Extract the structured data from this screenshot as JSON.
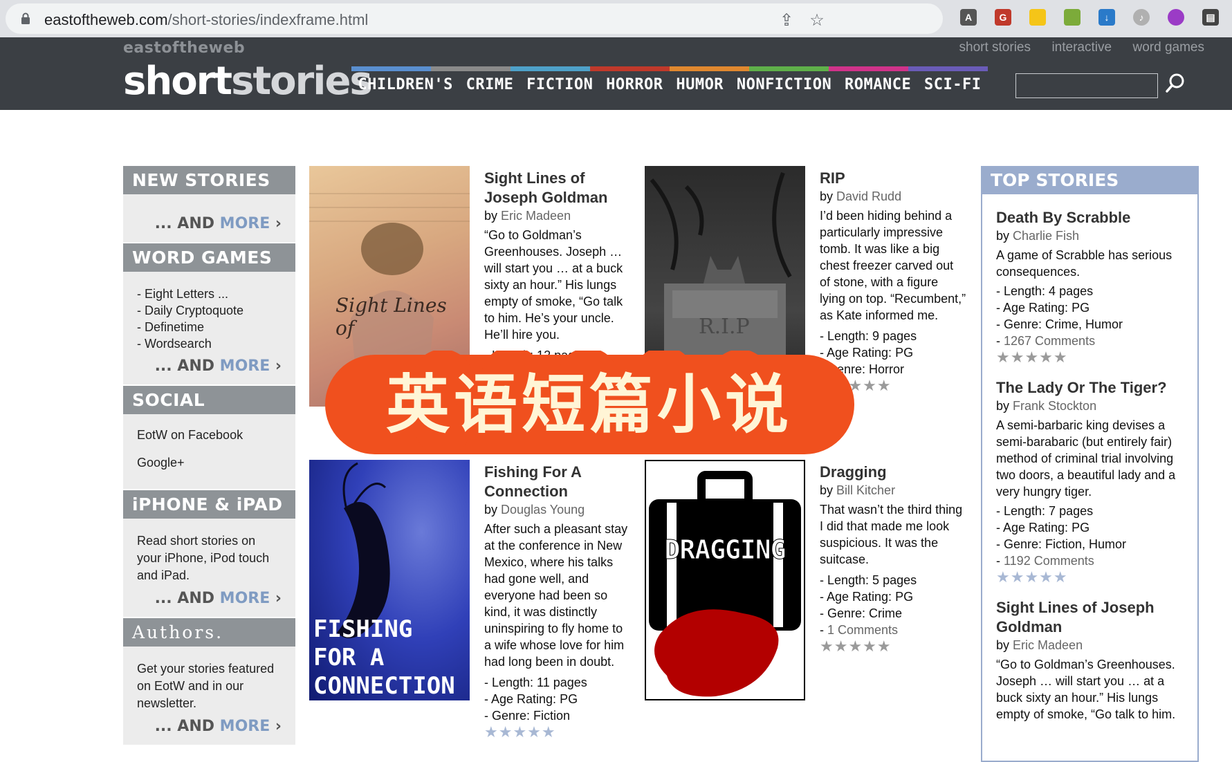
{
  "browser": {
    "url_domain": "eastoftheweb.com",
    "url_path": "/short-stories/indexframe.html",
    "share_icon": "share-icon",
    "bookmark_icon": "star-icon"
  },
  "site": {
    "brand_small": "eastoftheweb",
    "brand_big_1": "short",
    "brand_big_2": "stories",
    "top_links": [
      "short stories",
      "interactive",
      "word games"
    ],
    "categories": [
      "CHILDREN'S",
      "CRIME",
      "FICTION",
      "HORROR",
      "HUMOR",
      "NONFICTION",
      "ROMANCE",
      "SCI-FI"
    ],
    "category_colors": [
      "#5a8fd0",
      "#8a8a8a",
      "#4ea1c9",
      "#c0392b",
      "#e0882f",
      "#5fb04a",
      "#d0338a",
      "#6a5cb8"
    ],
    "search_placeholder": ""
  },
  "sidebar": {
    "new_stories": {
      "title": "NEW STORIES",
      "more_prefix": "... AND",
      "more_word": "MORE"
    },
    "word_games": {
      "title": "WORD GAMES",
      "items": [
        "- Eight Letters ...",
        "- Daily Cryptoquote",
        "- Definetime",
        "- Wordsearch"
      ],
      "more_prefix": "... AND",
      "more_word": "MORE"
    },
    "social": {
      "title": "SOCIAL",
      "items": [
        "EotW on Facebook",
        "Google+"
      ]
    },
    "iphone": {
      "title": "iPHONE & iPAD",
      "text": "Read short stories on your iPhone, iPod touch and iPad.",
      "more_prefix": "... AND",
      "more_word": "MORE"
    },
    "authors": {
      "title": "Authors.",
      "text": "Get your stories featured on EotW and in our newsletter.",
      "more_prefix": "... AND",
      "more_word": "MORE"
    }
  },
  "stories": [
    {
      "title": "Sight Lines of Joseph Goldman",
      "by": "by",
      "author": "Eric Madeen",
      "excerpt": "“Go to Goldman’s Greenhouses. Joseph … will start you … at a buck sixty an hour.” His lungs empty of smoke, “Go talk to him. He’s your uncle. He’ll hire you.",
      "meta": [
        "- Length: 12 pages"
      ],
      "thumb_text": "Sight Lines of"
    },
    {
      "title": "RIP",
      "by": "by",
      "author": "David Rudd",
      "excerpt": "I’d been hiding behind a particularly impressive tomb. It was like a big chest freezer carved out of stone, with a figure lying on top. “Recumbent,” as Kate informed me.",
      "meta": [
        "- Length: 9 pages",
        "- Age Rating: PG",
        "- Genre: Horror"
      ],
      "thumb_text": "R.I.P"
    },
    {
      "title": "Fishing For A Connection",
      "by": "by",
      "author": "Douglas Young",
      "excerpt": "After such a pleasant stay at the conference in New Mexico, where his talks had gone well, and everyone had been so kind, it was distinctly uninspiring to fly home to a wife whose love for him had long been in doubt.",
      "meta": [
        "- Length: 11 pages",
        "- Age Rating: PG",
        "- Genre: Fiction"
      ],
      "thumb_lines": [
        "FISHING",
        "FOR A",
        "CONNECTION"
      ]
    },
    {
      "title": "Dragging",
      "by": "by",
      "author": "Bill Kitcher",
      "excerpt": "That wasn’t the third thing I did that made me look suspicious. It was the suitcase.",
      "meta": [
        "- Length: 5 pages",
        "- Age Rating: PG",
        "- Genre: Crime"
      ],
      "comments": "1 Comments",
      "thumb_text": "DRAGGING"
    }
  ],
  "top_stories": {
    "title": "TOP STORIES",
    "items": [
      {
        "title": "Death By Scrabble",
        "by": "by",
        "author": "Charlie Fish",
        "excerpt": "A game of Scrabble has serious consequences.",
        "meta": [
          "- Length: 4 pages",
          "- Age Rating: PG",
          "- Genre: Crime, Humor"
        ],
        "comments": "1267 Comments"
      },
      {
        "title": "The Lady Or The Tiger?",
        "by": "by",
        "author": "Frank Stockton",
        "excerpt": "A semi-barbaric king devises a semi-barabaric (but entirely fair) method of criminal trial involving two doors, a beautiful lady and a very hungry tiger.",
        "meta": [
          "- Length: 7 pages",
          "- Age Rating: PG",
          "- Genre: Fiction, Humor"
        ],
        "comments": "1192 Comments"
      },
      {
        "title": "Sight Lines of Joseph Goldman",
        "by": "by",
        "author": "Eric Madeen",
        "excerpt": "“Go to Goldman’s Greenhouses. Joseph … will start you … at a buck sixty an hour.” His lungs empty of smoke, “Go talk to him."
      }
    ]
  },
  "rating": {
    "stars": "★★★★★",
    "value": 5
  },
  "overlay": {
    "text": "英语短篇小说",
    "color": "#f0501e",
    "text_color": "#fff5d6"
  }
}
